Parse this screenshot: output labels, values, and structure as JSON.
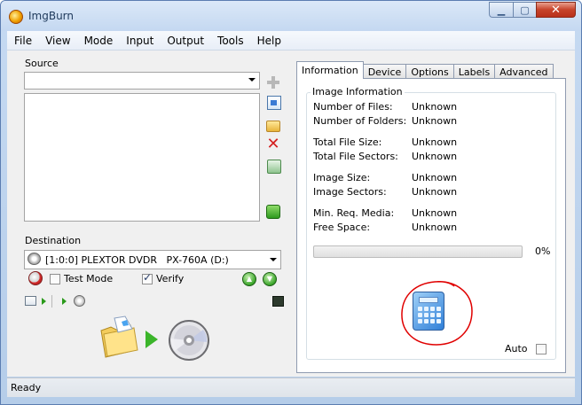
{
  "window": {
    "title": "ImgBurn"
  },
  "menu": [
    "File",
    "View",
    "Mode",
    "Input",
    "Output",
    "Tools",
    "Help"
  ],
  "source": {
    "label": "Source",
    "combo_value": ""
  },
  "destination": {
    "label": "Destination",
    "drive": "[1:0:0] PLEXTOR DVDR   PX-760A (D:)",
    "test_mode": {
      "label": "Test Mode",
      "checked": false
    },
    "verify": {
      "label": "Verify",
      "checked": true
    }
  },
  "tabs": [
    {
      "label": "Information",
      "active": true
    },
    {
      "label": "Device",
      "active": false
    },
    {
      "label": "Options",
      "active": false
    },
    {
      "label": "Labels",
      "active": false
    },
    {
      "label": "Advanced",
      "active": false
    }
  ],
  "image_info": {
    "group_label": "Image Information",
    "fields": [
      {
        "label": "Number of Files:",
        "value": "Unknown"
      },
      {
        "label": "Number of Folders:",
        "value": "Unknown"
      },
      {
        "label": "Total File Size:",
        "value": "Unknown"
      },
      {
        "label": "Total File Sectors:",
        "value": "Unknown"
      },
      {
        "label": "Image Size:",
        "value": "Unknown"
      },
      {
        "label": "Image Sectors:",
        "value": "Unknown"
      },
      {
        "label": "Min. Req. Media:",
        "value": "Unknown"
      },
      {
        "label": "Free Space:",
        "value": "Unknown"
      }
    ],
    "progress_percent": 0,
    "progress_label": "0%",
    "auto_label": "Auto",
    "auto_checked": false
  },
  "annotation_color": "#e00000",
  "status": {
    "text": "Ready"
  },
  "icons": [
    "imgburn-app-icon",
    "add-icon",
    "file-icon",
    "folder-icon",
    "delete-icon",
    "recycle-icon",
    "go-icon",
    "drive-icon",
    "eraser-icon",
    "calculator-icon",
    "disc-icon",
    "folder-large-icon"
  ]
}
